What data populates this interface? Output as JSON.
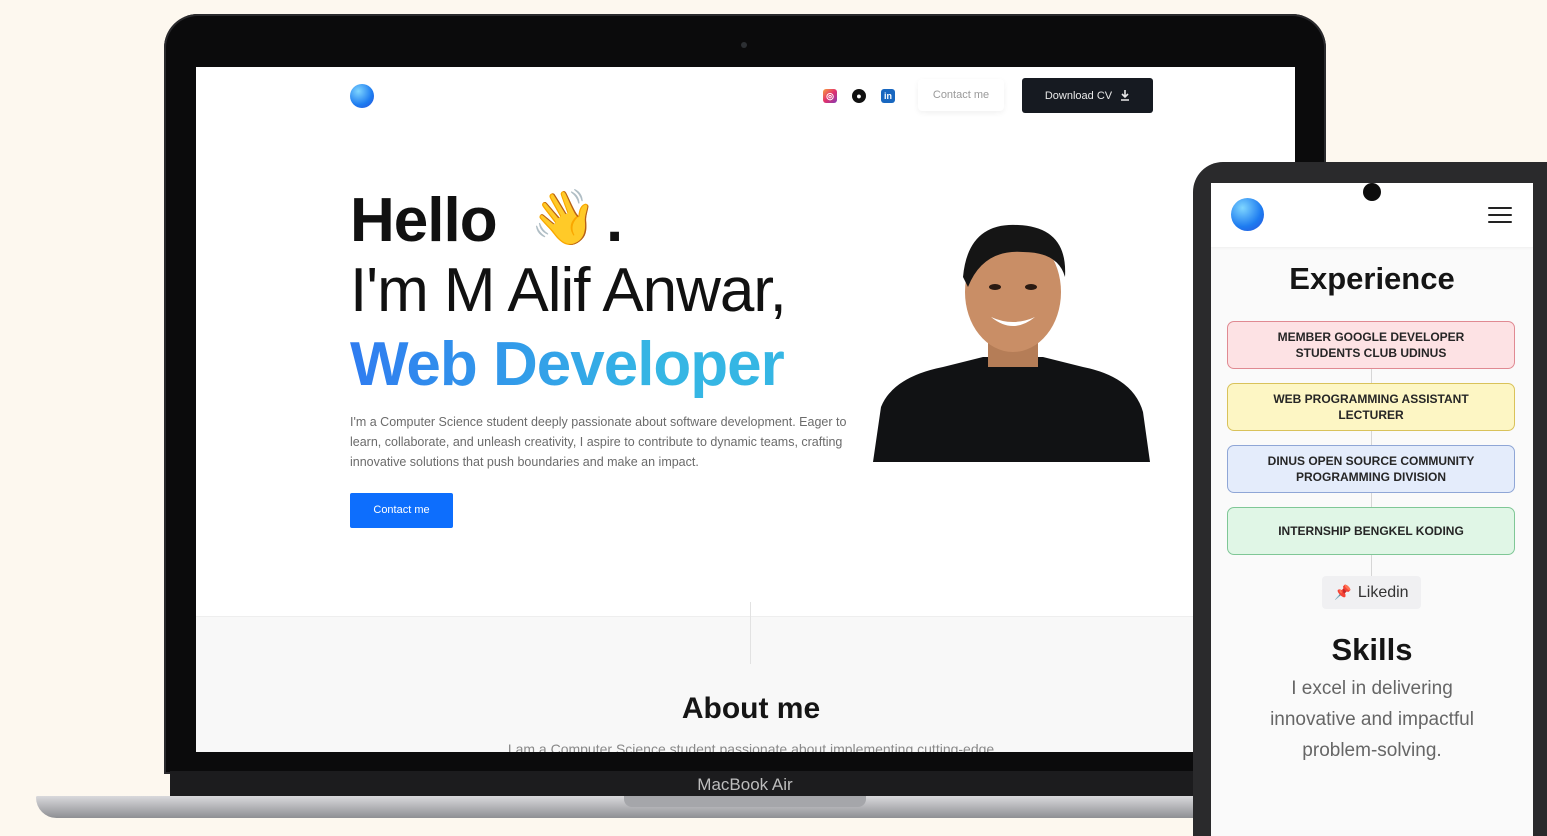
{
  "laptop": {
    "hinge_label": "MacBook Air",
    "nav": {
      "contact_label": "Contact me",
      "download_label": "Download CV",
      "social_icons": [
        "instagram-icon",
        "github-icon",
        "linkedin-icon"
      ]
    },
    "hero": {
      "greeting": "Hello",
      "wave_emoji": "👋",
      "greeting_punct": ".",
      "name_line": "I'm M Alif Anwar,",
      "role": "Web Developer",
      "intro": "I'm a Computer Science student deeply passionate about software development. Eager to learn, collaborate, and unleash creativity, I aspire to contribute to dynamic teams, crafting innovative solutions that push boundaries and make an impact.",
      "cta_label": "Contact me"
    },
    "about": {
      "title": "About me",
      "text": "I am a Computer Science student passionate about implementing cutting-edge"
    }
  },
  "phone": {
    "experience_title": "Experience",
    "experience": [
      {
        "label": "MEMBER GOOGLE DEVELOPER STUDENTS CLUB UDINUS",
        "bg": "#fde2e4",
        "border": "#e08a92"
      },
      {
        "label": "WEB PROGRAMMING ASSISTANT LECTURER",
        "bg": "#fdf6c4",
        "border": "#d9c25a"
      },
      {
        "label": "DINUS OPEN SOURCE COMMUNITY PROGRAMMING DIVISION",
        "bg": "#e4ecfb",
        "border": "#8fa6d6"
      },
      {
        "label": "INTERNSHIP BENGKEL KODING",
        "bg": "#e0f6e6",
        "border": "#7fc796"
      }
    ],
    "linkedin_label": "Likedin",
    "skills_title": "Skills",
    "skills_text": "I excel in delivering innovative and impactful problem-solving."
  },
  "colors": {
    "page_bg": "#fdf8ef",
    "accent_blue": "#0d6efd",
    "dark_button": "#161a21"
  }
}
